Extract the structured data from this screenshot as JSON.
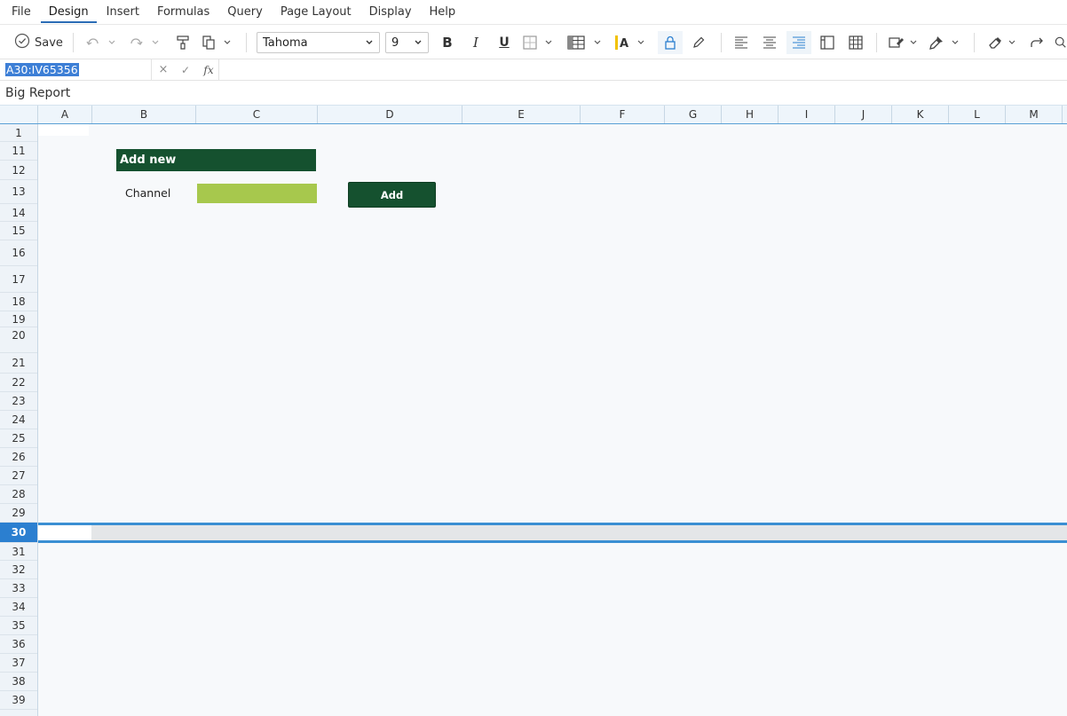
{
  "menu": {
    "items": [
      "File",
      "Design",
      "Insert",
      "Formulas",
      "Query",
      "Page Layout",
      "Display",
      "Help"
    ],
    "active": "Design"
  },
  "toolbar": {
    "save_label": "Save",
    "font_family": "Tahoma",
    "font_size": "9",
    "icons": [
      "save-icon",
      "undo-icon",
      "redo-icon",
      "format-painter-icon",
      "paste-icon",
      "bold-icon",
      "italic-icon",
      "underline-icon",
      "borders-icon",
      "table-grid-icon",
      "font-color-icon",
      "lock-icon",
      "pencil-icon",
      "align-left-icon",
      "align-center-icon",
      "align-right-icon",
      "freeze-panes-icon",
      "table-icon",
      "fill-color-icon",
      "brush-icon",
      "eraser-icon",
      "redo-arrow-icon",
      "search-icon"
    ]
  },
  "formula_bar": {
    "name_box": "A30:IV65356",
    "cancel": "×",
    "confirm": "✓",
    "fx": "fx",
    "formula": ""
  },
  "report": {
    "title": "Big Report"
  },
  "sheet": {
    "columns": [
      "A",
      "B",
      "C",
      "D",
      "E",
      "F",
      "G",
      "H",
      "I",
      "J",
      "K",
      "L",
      "M"
    ],
    "rows": [
      "1",
      "11",
      "12",
      "13",
      "14",
      "15",
      "16",
      "17",
      "18",
      "19",
      "20",
      "21",
      "22",
      "23",
      "24",
      "25",
      "26",
      "27",
      "28",
      "29",
      "30",
      "31",
      "32",
      "33",
      "34",
      "35",
      "36",
      "37",
      "38",
      "39"
    ],
    "selected_row": "30",
    "header_text": "Add new",
    "channel_label": "Channel",
    "channel_value": "",
    "add_button": "Add"
  },
  "colors": {
    "accent": "#2b6cb5",
    "header_green": "#15512f",
    "input_green": "#a7c84d",
    "selection_blue": "#3a8fd3"
  }
}
